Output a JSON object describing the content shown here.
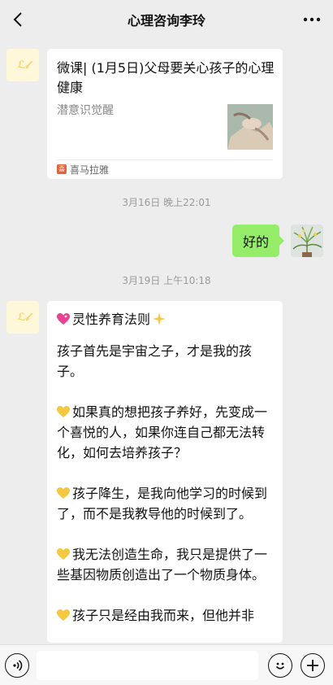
{
  "header": {
    "title": "心理咨询李玲",
    "back_icon": "chevron-left-icon",
    "more_icon": "more-dots-icon"
  },
  "messages": {
    "card": {
      "title": "微课| (1月5日)父母要关心孩子的心理健康",
      "description": "潜意识觉醒",
      "source": "喜马拉雅",
      "source_icon_text": "喜"
    },
    "timestamp_1": "3月16日 晚上22:01",
    "outgoing_text": "好的",
    "timestamp_2": "3月19日 上午10:18",
    "long_text": {
      "title": "灵性养育法则",
      "p1": "孩子首先是宇宙之子，才是我的孩子。",
      "p2": "如果真的想把孩子养好，先变成一个喜悦的人，如果你连自己都无法转化，如何去培养孩子？",
      "p3": "孩子降生，是我向他学习的时候到了，而不是我教导他的时候到了。",
      "p4": "我无法创造生命，我只是提供了一些基因物质创造出了一个物质身体。",
      "p5": "孩子只是经由我而来，但他并非"
    }
  },
  "colors": {
    "background": "#ededed",
    "outgoing_bubble": "#95ec69",
    "incoming_bubble": "#ffffff",
    "heart_emoji": "#f5c842",
    "sparkle_heart": "#e84393"
  }
}
